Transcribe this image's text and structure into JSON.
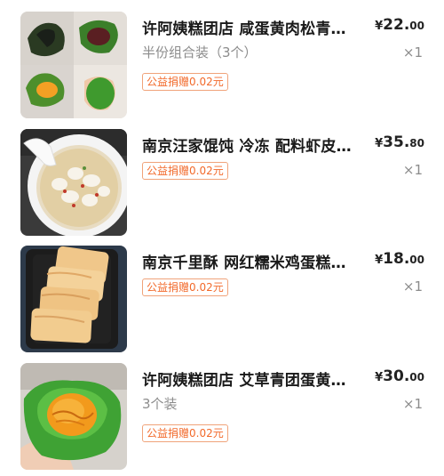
{
  "items": [
    {
      "title": "许阿姨糕团店 咸蛋黄肉松青团网红...",
      "spec": "半份组合装（3个）",
      "badge": "公益捐赠0.02元",
      "currency": "¥",
      "price_int": "22.",
      "price_dec": "00",
      "qty": "×1",
      "thumb_icon": "qingtuan-photo-icon"
    },
    {
      "title": "南京汪家馄饨 冷冻 配料虾皮紫菜...",
      "spec": "",
      "badge": "公益捐赠0.02元",
      "currency": "¥",
      "price_int": "35.",
      "price_dec": "80",
      "qty": "×1",
      "thumb_icon": "wonton-soup-photo-icon"
    },
    {
      "title": "南京千里酥 网红糯米鸡蛋糕早餐...",
      "spec": "",
      "badge": "公益捐赠0.02元",
      "currency": "¥",
      "price_int": "18.",
      "price_dec": "00",
      "qty": "×1",
      "thumb_icon": "rice-cake-photo-icon"
    },
    {
      "title": "许阿姨糕团店 艾草青团蛋黄肉松...",
      "spec": "3个装",
      "badge": "公益捐赠0.02元",
      "currency": "¥",
      "price_int": "30.",
      "price_dec": "00",
      "qty": "×1",
      "thumb_icon": "qingtuan-yolk-photo-icon"
    }
  ],
  "colors": {
    "badge_text": "#f26a2b",
    "badge_border": "#f0a37a",
    "muted_text": "#8c8c8c"
  }
}
